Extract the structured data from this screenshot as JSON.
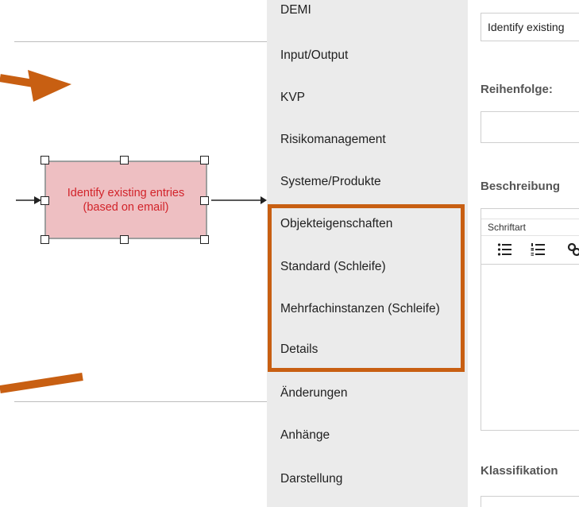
{
  "canvas": {
    "task": {
      "line1": "Identify existing entries",
      "line2": "(based on email)",
      "fill_color": "#eebfc2",
      "text_color": "#d2232a"
    },
    "annotation_color": "#c85f12"
  },
  "menu": {
    "items": [
      {
        "label": "DEMI"
      },
      {
        "label": "Input/Output"
      },
      {
        "label": "KVP"
      },
      {
        "label": "Risikomanagement"
      },
      {
        "label": "Systeme/Produkte"
      },
      {
        "label": "Objekteigenschaften"
      },
      {
        "label": "Standard (Schleife)"
      },
      {
        "label": "Mehrfachinstanzen (Schleife)"
      },
      {
        "label": "Details"
      },
      {
        "label": "Änderungen"
      },
      {
        "label": "Anhänge"
      },
      {
        "label": "Darstellung"
      }
    ],
    "highlight_color": "#c85f12"
  },
  "form": {
    "name_value": "Identify existing",
    "reihenfolge_label": "Reihenfolge:",
    "reihenfolge_value": "",
    "beschreibung_label": "Beschreibung",
    "editor_font_placeholder": "Schriftart",
    "klassifikation_label": "Klassifikation"
  }
}
